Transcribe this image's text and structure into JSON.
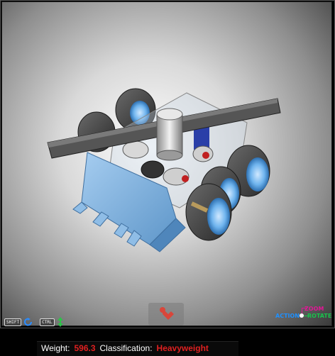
{
  "viewer": {
    "controls": {
      "shift_key": "SHIFT",
      "ctrl_key": "CTRL"
    },
    "legend": {
      "zoom": "ZOOM",
      "action": "ACTION",
      "rotate": "ROTATE"
    },
    "accent_colors": {
      "zoom": "#e01896",
      "action": "#1e90ff",
      "rotate": "#19c24c",
      "value": "#e02020"
    }
  },
  "status": {
    "weight_label": "Weight:",
    "weight_value": "596.3",
    "classification_label": "Classification:",
    "classification_value": "Heavyweight"
  },
  "icons": {
    "rotate": "rotate-icon",
    "move_vertical": "move-vertical-icon",
    "tool": "tool-wrench-icon"
  }
}
